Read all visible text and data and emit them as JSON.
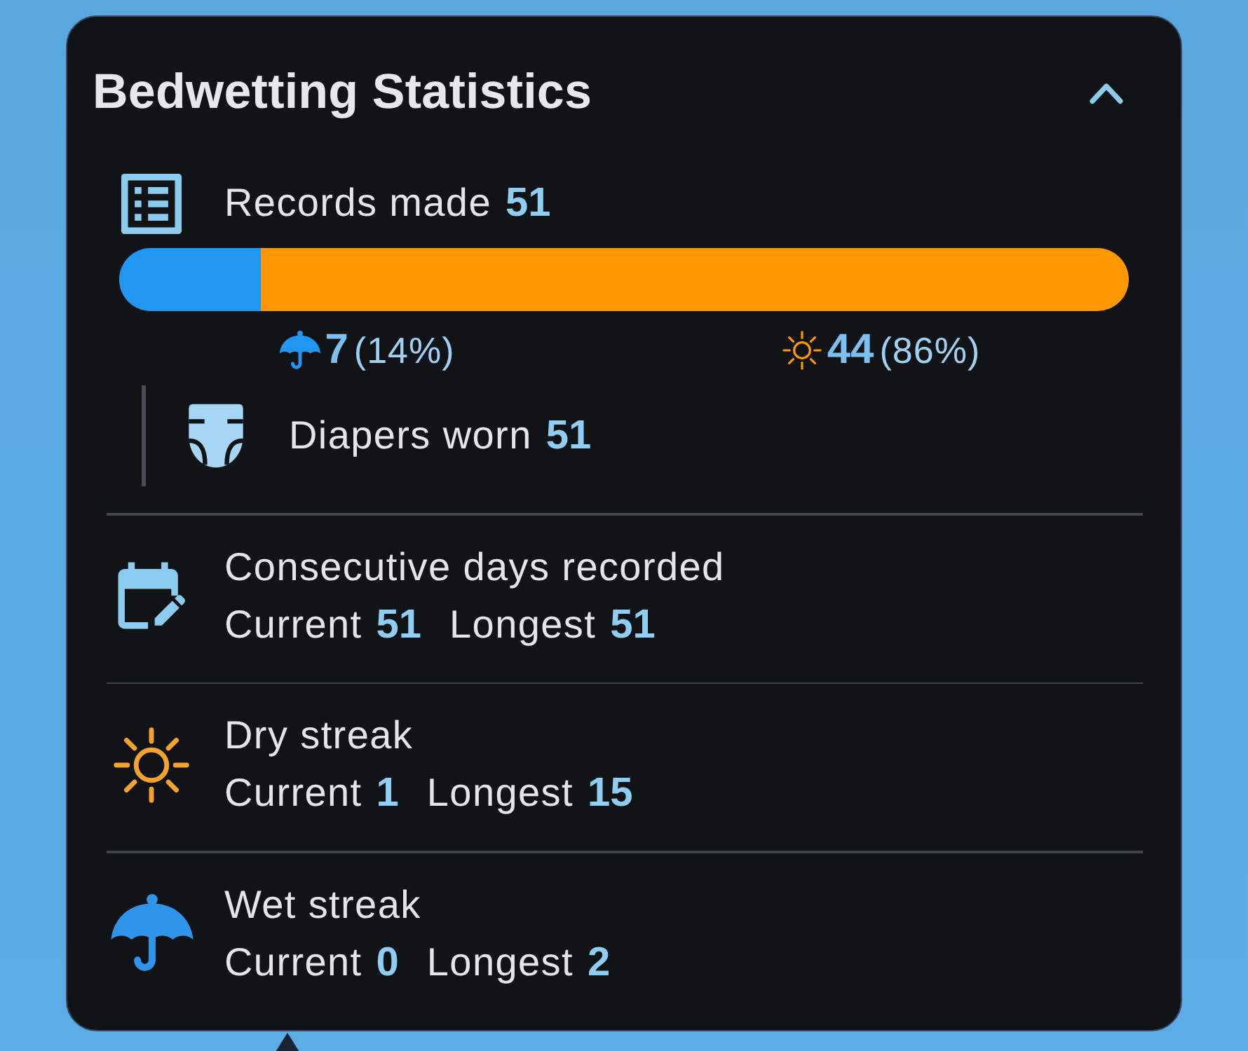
{
  "card": {
    "title": "Bedwetting Statistics",
    "expanded": true
  },
  "records": {
    "label": "Records made",
    "value": "51",
    "split": [
      {
        "kind": "wet",
        "color": "#2196f3",
        "level": 0.14,
        "count": "7",
        "percent": "(14%)"
      },
      {
        "kind": "dry",
        "color": "#ff9800",
        "level": 0.86,
        "count": "44",
        "percent": "(86%)"
      }
    ],
    "diapers": {
      "label": "Diapers worn",
      "value": "51"
    }
  },
  "streaks": [
    {
      "kind": "calendar",
      "title": "Consecutive days recorded",
      "current_label": "Current",
      "current": "51",
      "longest_label": "Longest",
      "longest": "51"
    },
    {
      "kind": "dry",
      "title": "Dry streak",
      "current_label": "Current",
      "current": "1",
      "longest_label": "Longest",
      "longest": "15"
    },
    {
      "kind": "wet",
      "title": "Wet streak",
      "current_label": "Current",
      "current": "0",
      "longest_label": "Longest",
      "longest": "2"
    }
  ]
}
